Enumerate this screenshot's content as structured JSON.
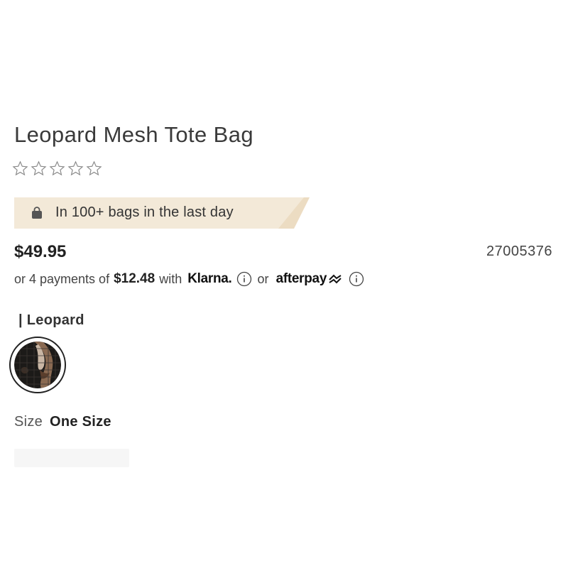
{
  "product": {
    "title": "Leopard Mesh Tote Bag",
    "rating": 0,
    "rating_max": 5,
    "sku": "27005376",
    "price": "$49.95"
  },
  "banner": {
    "text": "In 100+ bags in the last day",
    "icon": "shopping-bag-icon",
    "background": "#f3e9d8"
  },
  "payments": {
    "prefix": "or 4 payments of",
    "amount": "$12.48",
    "with_text": "with",
    "klarna_label": "Klarna.",
    "or_text": "or",
    "afterpay_label": "afterpay"
  },
  "color": {
    "label": "| Leopard",
    "selected_swatch": "leopard"
  },
  "size": {
    "label": "Size",
    "value": "One Size"
  }
}
